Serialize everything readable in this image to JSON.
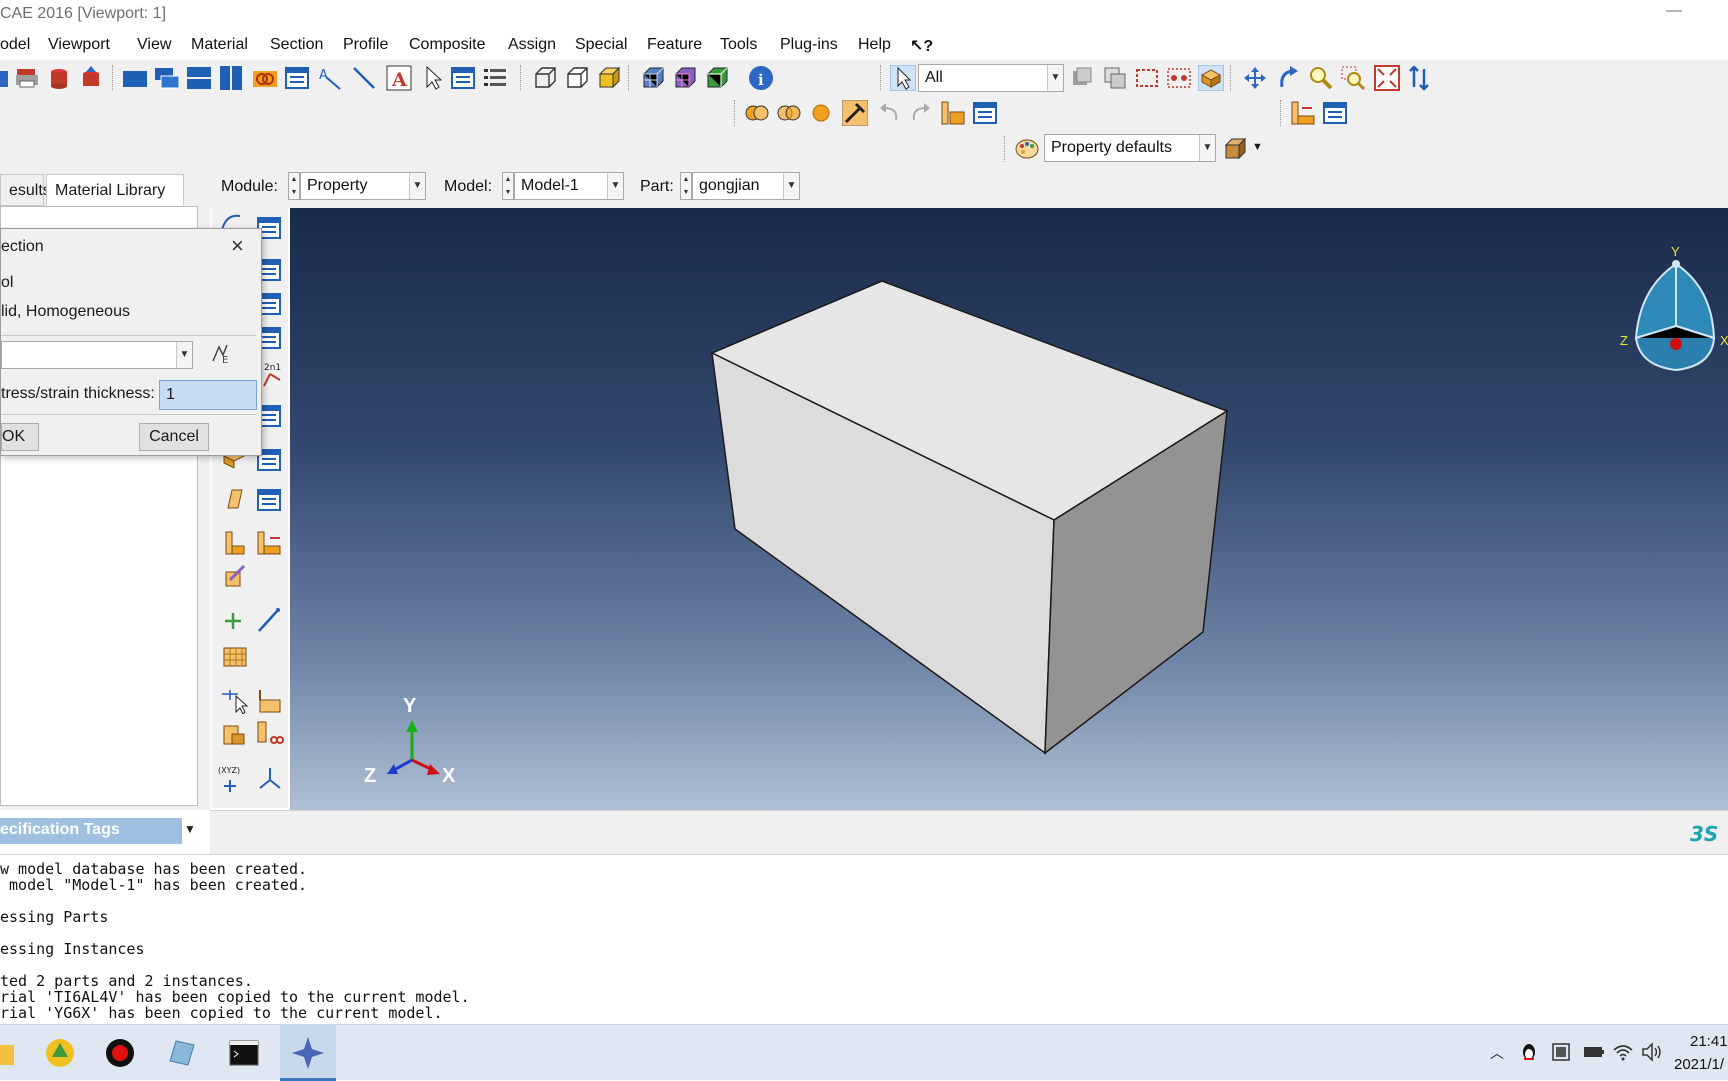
{
  "window": {
    "title": "CAE 2016 [Viewport: 1]",
    "minimize": "—"
  },
  "menu": [
    {
      "label": "odel"
    },
    {
      "label": "Viewport"
    },
    {
      "label": "View"
    },
    {
      "label": "Material"
    },
    {
      "label": "Section"
    },
    {
      "label": "Profile"
    },
    {
      "label": "Composite"
    },
    {
      "label": "Assign"
    },
    {
      "label": "Special"
    },
    {
      "label": "Feature"
    },
    {
      "label": "Tools"
    },
    {
      "label": "Plug-ins"
    },
    {
      "label": "Help"
    },
    {
      "label": "↖?"
    }
  ],
  "toolbar": {
    "selection_filter": "All",
    "render_style": "Property defaults"
  },
  "context": {
    "module_label": "Module:",
    "module_value": "Property",
    "model_label": "Model:",
    "model_value": "Model-1",
    "part_label": "Part:",
    "part_value": "gongjian"
  },
  "tabs": {
    "results": "esults",
    "library": "Material Library"
  },
  "dialog": {
    "title": "ection",
    "close": "×",
    "row1": "ol",
    "row2": "lid, Homogeneous",
    "thickness_label": "tress/strain thickness:",
    "thickness_value": "1",
    "ok": "OK",
    "cancel": "Cancel"
  },
  "spec_tags": "ecification Tags",
  "triad": {
    "x": "X",
    "y": "Y",
    "z": "Z"
  },
  "compass": {
    "x": "X",
    "y": "Y",
    "z": "Z"
  },
  "messages": [
    "w model database has been created.",
    " model \"Model-1\" has been created.",
    "",
    "essing Parts",
    "",
    "essing Instances",
    "",
    "ted 2 parts and 2 instances.",
    "rial 'TI6AL4V' has been copied to the current model.",
    "rial 'YG6X' has been copied to the current model."
  ],
  "taskbar": {
    "time": "21:41",
    "date": "2021/1/"
  },
  "colors": {
    "viewport_top": "#1a2a4a",
    "viewport_bottom": "#b0bfd4",
    "spec_tags_bg": "#9fc0e0",
    "input_highlight": "#c6dcf5"
  }
}
